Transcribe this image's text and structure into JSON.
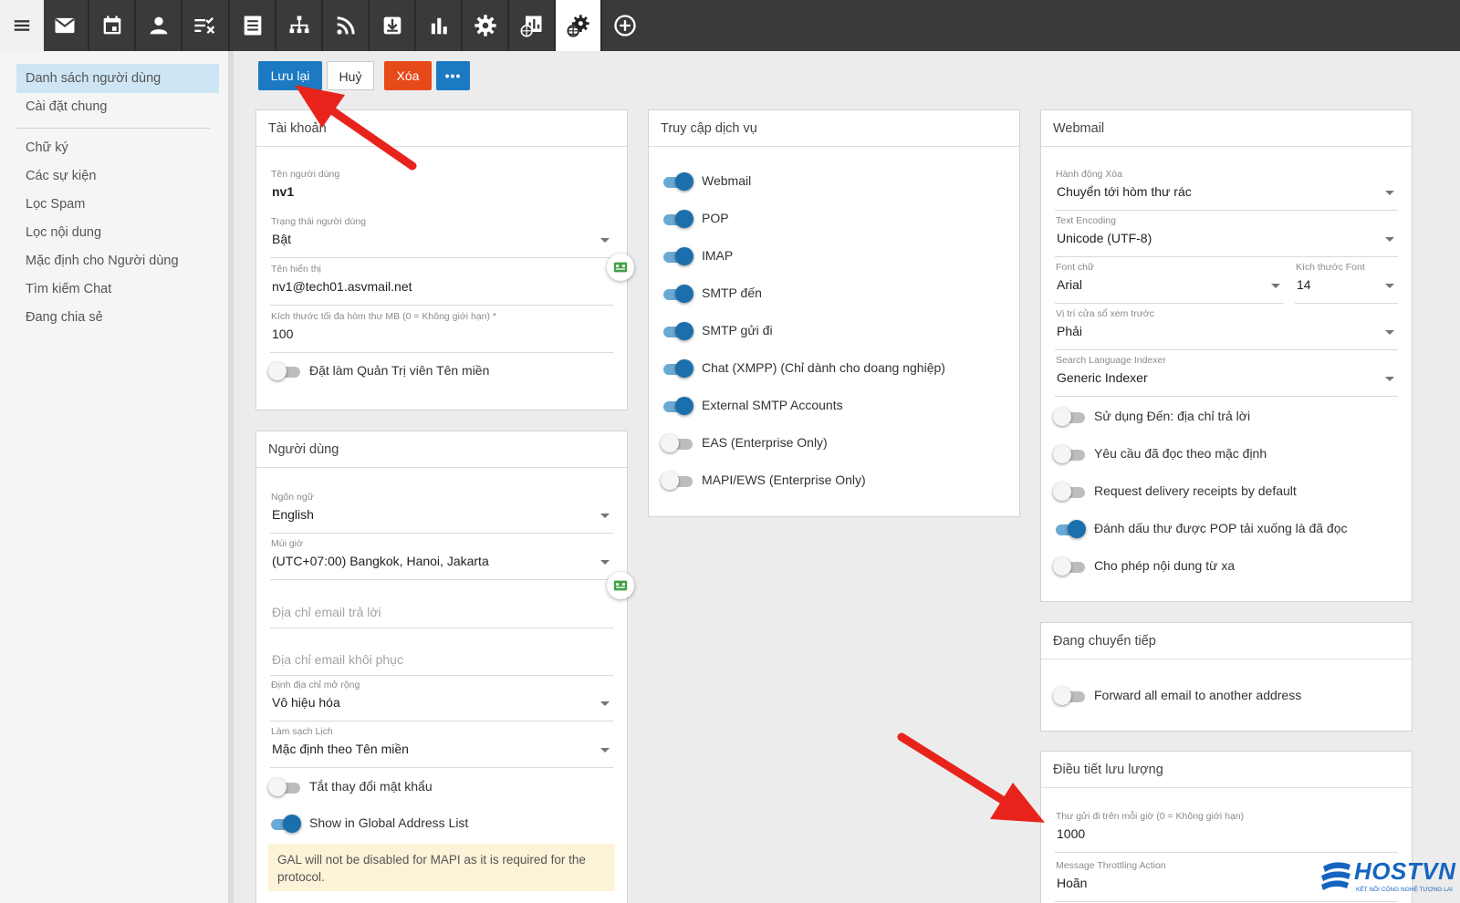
{
  "toolbar": {
    "icons": [
      "menu-icon",
      "mail-icon",
      "calendar-icon",
      "contacts-icon",
      "tasks-icon",
      "notes-icon",
      "sitemap-icon",
      "rss-icon",
      "download-icon",
      "bar-chart-icon",
      "settings-gear-icon",
      "reports-icon",
      "domain-settings-icon",
      "add-circle-icon"
    ],
    "active": "domain-settings-icon"
  },
  "sidebar": {
    "items": [
      {
        "label": "Danh sách người dùng",
        "active": true
      },
      {
        "label": "Cài đặt chung"
      },
      {
        "label": "Chữ ký"
      },
      {
        "label": "Các sự kiện"
      },
      {
        "label": "Lọc Spam"
      },
      {
        "label": "Lọc nội dung"
      },
      {
        "label": "Mặc định cho Người dùng"
      },
      {
        "label": "Tìm kiếm Chat"
      },
      {
        "label": "Đang chia sẻ"
      }
    ]
  },
  "actions": {
    "save": "Lưu lại",
    "cancel": "Huỷ",
    "delete": "Xóa",
    "more": "•••"
  },
  "account": {
    "title": "Tài khoản",
    "username_label": "Tên người dùng",
    "username": "nv1",
    "status_label": "Trạng thái người dùng",
    "status": "Bật",
    "display_name_label": "Tên hiển thị",
    "display_name": "nv1@tech01.asvmail.net",
    "mailbox_size_label": "Kích thước tối đa hòm thư MB (0 = Không giới hạn) *",
    "mailbox_size": "100",
    "domain_admin_label": "Đặt làm Quản Trị viên Tên miền",
    "domain_admin": false
  },
  "user": {
    "title": "Người dùng",
    "language_label": "Ngôn ngữ",
    "language": "English",
    "timezone_label": "Múi giờ",
    "timezone": "(UTC+07:00) Bangkok, Hanoi, Jakarta",
    "reply_email_placeholder": "Địa chỉ email trả lời",
    "recovery_email_placeholder": "Địa chỉ email khôi phục",
    "plus_address_label": "Định địa chỉ mở rộng",
    "plus_address": "Vô hiệu hóa",
    "calendar_cleanup_label": "Làm sạch Lịch",
    "calendar_cleanup": "Mặc định theo Tên miền",
    "disable_password_change_label": "Tắt thay đổi mật khẩu",
    "disable_password_change": false,
    "show_gal_label": "Show in Global Address List",
    "show_gal": true,
    "gal_notice": "GAL will not be disabled for MAPI as it is required for the protocol."
  },
  "services": {
    "title": "Truy cập dịch vụ",
    "items": [
      {
        "label": "Webmail",
        "on": true
      },
      {
        "label": "POP",
        "on": true
      },
      {
        "label": "IMAP",
        "on": true
      },
      {
        "label": "SMTP đến",
        "on": true
      },
      {
        "label": "SMTP gửi đi",
        "on": true
      },
      {
        "label": "Chat (XMPP) (Chỉ dành cho doang nghiệp)",
        "on": true
      },
      {
        "label": "External SMTP Accounts",
        "on": true
      },
      {
        "label": "EAS (Enterprise Only)",
        "on": false
      },
      {
        "label": "MAPI/EWS (Enterprise Only)",
        "on": false
      }
    ]
  },
  "webmail": {
    "title": "Webmail",
    "delete_action_label": "Hành động Xóa",
    "delete_action": "Chuyển tới hòm thư rác",
    "encoding_label": "Text Encoding",
    "encoding": "Unicode (UTF-8)",
    "font_label": "Font chữ",
    "font": "Arial",
    "font_size_label": "Kích thước Font",
    "font_size": "14",
    "preview_label": "Vị trí cửa sổ xem trước",
    "preview": "Phải",
    "indexer_label": "Search Language Indexer",
    "indexer": "Generic Indexer",
    "toggles": [
      {
        "label": "Sử dụng Đến: địa chỉ trả lời",
        "on": false
      },
      {
        "label": "Yêu cầu đã đọc theo mặc định",
        "on": false
      },
      {
        "label": "Request delivery receipts by default",
        "on": false
      },
      {
        "label": "Đánh dấu thư được POP tải xuống là đã đọc",
        "on": true
      },
      {
        "label": "Cho phép nội dung từ xa",
        "on": false
      }
    ]
  },
  "forwarding": {
    "title": "Đang chuyển tiếp",
    "forward_label": "Forward all email to another address",
    "forward": false
  },
  "throttling": {
    "title": "Điều tiết lưu lượng",
    "per_hour_label": "Thư gửi đi trên mỗi giờ (0 = Không giới hạn)",
    "per_hour": "1000",
    "action_label": "Message Throttling Action",
    "action": "Hoãn"
  },
  "logo": {
    "name": "HOSTVN",
    "tagline": "KẾT NỐI CÔNG NGHỆ TƯƠNG LAI"
  },
  "colors": {
    "primary": "#1b7ac2",
    "danger": "#e64a19",
    "toolbar": "#3a3a3a",
    "arrow": "#e8231c"
  }
}
